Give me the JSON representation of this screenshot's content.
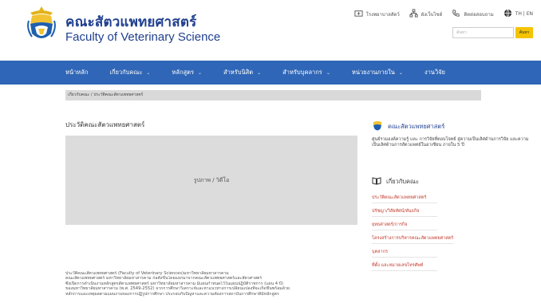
{
  "header": {
    "title_th": "คณะสัตวแพทยศาสตร์",
    "title_en": "Faculty of Veterinary Science",
    "logo_icon": "university-seal-icon"
  },
  "toplinks": [
    {
      "label": "โรงพยาบาลสัตว์",
      "icon": "hospital-icon"
    },
    {
      "label": "ผังเว็บไซต์",
      "icon": "sitemap-icon"
    },
    {
      "label": "ติดต่อสอบถาม",
      "icon": "phone-icon"
    },
    {
      "label": "TH | EN",
      "icon": "globe-icon"
    }
  ],
  "search": {
    "placeholder": "ค้นหา",
    "button_label": "ค้นหา"
  },
  "nav": {
    "items": [
      {
        "label": "หน้าหลัก",
        "has_dropdown": false
      },
      {
        "label": "เกี่ยวกับคณะ",
        "has_dropdown": true
      },
      {
        "label": "หลักสูตร",
        "has_dropdown": true
      },
      {
        "label": "สำหรับนิสิต",
        "has_dropdown": true
      },
      {
        "label": "สำหรับบุคลากร",
        "has_dropdown": true
      },
      {
        "label": "หน่วยงานภายใน",
        "has_dropdown": true
      },
      {
        "label": "งานวิจัย",
        "has_dropdown": false
      }
    ]
  },
  "breadcrumb": "เกี่ยวกับคณะ / ประวัติคณะสัตวแพทยศาสตร์",
  "main": {
    "heading": "ประวัติคณะสัตวแพทยศาสตร์",
    "media_label": "รูปภาพ / วิดีโอ",
    "body_lines": [
      "ประวัติคณะสัตวแพทยศาสตร์ (Faculty of Veterinary Sciences)มหาวิทยาลัยมหาสารคาม",
      "คณะสัตวแพทยศาสตร์ มหาวิทยาลัยมหาสารคาม ก่อตั้งขึ้นโดยแยกมาจากคณะสัตวแพทยศาสตร์และสัตวศาสตร์",
      "ซึ่งเปิดการดำเนินงานหลักสูตรสัตวแพทยศาสตร์ มหาวิทยาลัยมหาสารคาม มีแผนกำหนดไว้ในแผนปฏิบัติราชการ (แผน 4 ปี)",
      "ของมหาวิทยาลัยมหาสารคาม (พ.ศ. 2549-2552) จากการศึกษาวิเคราะห์และหาแนวทางการเปลี่ยนแปลงที่จะเกิดขึ้นพร้อมด้วย",
      "หลักการและเหตุผลตามแผนงานของการปฏิรูปการศึกษา ประกอบกับปัญหาและความต้องการสถาบันการศึกษาที่มีหลักสูตร"
    ]
  },
  "sidebar": {
    "about": {
      "title": "คณะสัตวแพทยศาสตร์",
      "description": "ศูนย์รวมองค์ความรู้ และ การวิจัยที่ตอบโจทย์ สู่ความเป็นเลิศด้านการวิจัย และความเป็นเลิศด้านการสัตวแพทย์ในอาเซียน ภายใน 5 ปี"
    },
    "links_title": "เกี่ยวกับคณะ",
    "links": [
      "ประวัติคณะสัตวแพทยศาสตร์",
      "ปรัชญา/วิสัยทัศน์/พันธกิจ",
      "ยุทธศาสตร์/การกิจ",
      "โครงสร้างการบริหารคณะสัตวแพทยศาสตร์",
      "บุคลากร",
      "ที่ตั้ง และหมายเลขโทรศัพท์"
    ]
  },
  "colors": {
    "brand_blue": "#1f3f8f",
    "nav_blue": "#2f66b7",
    "accent_yellow": "#f5c400",
    "link_red": "#c0392b"
  }
}
